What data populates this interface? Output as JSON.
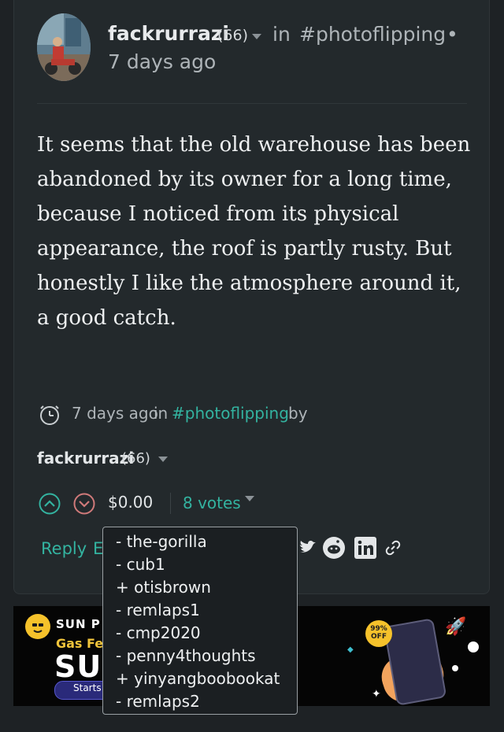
{
  "post": {
    "author": "fackrurrazi",
    "reputation": "(66)",
    "community_prefix": "in",
    "community": "#photoflipping",
    "separator": "•",
    "time": "7 days ago",
    "body": "It seems that the old warehouse has been abandoned by its owner for a long time, because I noticed from its physical appearance, the roof is partly rusty. But honestly I like the atmosphere around it, a good catch."
  },
  "footer": {
    "time": "7 days ago",
    "in": "in",
    "community": "#photoflipping",
    "by": "by",
    "author": "fackrurrazi",
    "reputation": "(66)",
    "payout": "$0.00",
    "votes": "8 votes",
    "reply": "Reply",
    "edit_peek": "E"
  },
  "icons": {
    "clock": "clock-icon",
    "upvote": "upvote-icon",
    "downvote": "downvote-icon",
    "caret": "caret-down-icon",
    "twitter": "twitter-icon",
    "reddit": "reddit-icon",
    "linkedin": "linkedin-icon",
    "link": "link-icon"
  },
  "voters": [
    "- the-gorilla",
    "- cub1",
    "+ otisbrown",
    "- remlaps1",
    "- cmp2020",
    "- penny4thoughts",
    "+ yinyangboobookat",
    "- remlaps2"
  ],
  "banner": {
    "brand": "SUN P",
    "subtitle": "Gas Fe",
    "headline": "SU",
    "button": "Starts",
    "badge": "99% OFF"
  },
  "colors": {
    "background": "#1e2225",
    "card": "#23292c",
    "accent": "#33b3a0",
    "upvote": "#33b3a0",
    "downvote": "#d07a7a"
  }
}
